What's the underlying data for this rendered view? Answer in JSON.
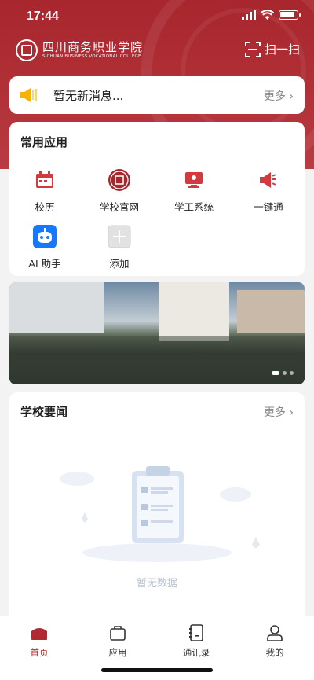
{
  "status_bar": {
    "time": "17:44"
  },
  "header": {
    "school_name": "四川商务职业学院",
    "school_name_en": "SICHUAN BUSINESS VOCATIONAL COLLEGE",
    "scan_label": "扫一扫",
    "brand_color": "#a8262d"
  },
  "notice": {
    "message": "暂无新消息...",
    "more_label": "更多"
  },
  "apps": {
    "title": "常用应用",
    "items": [
      {
        "label": "校历",
        "icon": "calendar-icon"
      },
      {
        "label": "学校官网",
        "icon": "school-emblem-icon"
      },
      {
        "label": "学工系统",
        "icon": "monitor-icon"
      },
      {
        "label": "一键通",
        "icon": "megaphone-icon"
      },
      {
        "label": "AI 助手",
        "icon": "robot-icon"
      },
      {
        "label": "添加",
        "icon": "add-icon"
      }
    ]
  },
  "banner": {
    "slide_count": 3,
    "active_index": 0
  },
  "news": {
    "title": "学校要闻",
    "more_label": "更多",
    "empty_text": "暂无数据"
  },
  "tabbar": {
    "active": "首页",
    "items": [
      {
        "label": "首页",
        "icon": "home-icon"
      },
      {
        "label": "应用",
        "icon": "briefcase-icon"
      },
      {
        "label": "通讯录",
        "icon": "contacts-icon"
      },
      {
        "label": "我的",
        "icon": "user-icon"
      }
    ]
  }
}
